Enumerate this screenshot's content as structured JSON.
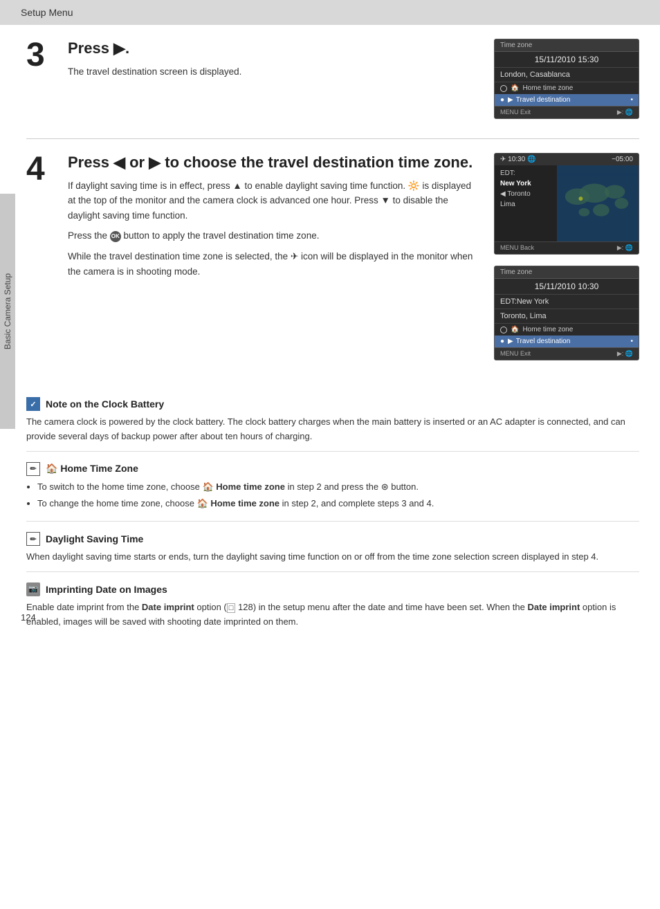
{
  "header": {
    "title": "Setup Menu"
  },
  "sidebar": {
    "label": "Basic Camera Setup"
  },
  "step3": {
    "number": "3",
    "title_prefix": "Press ",
    "title_arrow": "▶",
    "title_suffix": ".",
    "desc": "The travel destination screen is displayed.",
    "cam1": {
      "header": "Time zone",
      "date": "15/11/2010 15:30",
      "location": "London, Casablanca",
      "row1": "Home time zone",
      "row2": "Travel destination",
      "footer_left": "MENU Exit",
      "footer_right": "▶: 🌐"
    }
  },
  "step4": {
    "number": "4",
    "title": "Press ◀ or ▶ to choose the travel destination time zone.",
    "desc1": "If daylight saving time is in effect, press ▲ to enable daylight saving time function. 🔆 is displayed at the top of the monitor and the camera clock is advanced one hour. Press ▼ to disable the daylight saving time function.",
    "desc2": "Press the ⊛ button to apply the travel destination time zone.",
    "desc3": "While the travel destination time zone is selected, the ✈ icon will be displayed in the monitor when the camera is in shooting mode.",
    "cam_map": {
      "header_left": "✈ 10:30 🌐",
      "header_right": "−05:00",
      "cities": [
        "EDT:",
        "New York",
        "Toronto",
        "Lima"
      ],
      "footer_left": "MENU Back",
      "footer_right": "▶: 🌐"
    },
    "cam2": {
      "header": "Time zone",
      "date": "15/11/2010 10:30",
      "location1": "EDT:New York",
      "location2": "Toronto, Lima",
      "row1": "Home time zone",
      "row2": "Travel destination",
      "footer_left": "MENU Exit",
      "footer_right": "▶: 🌐"
    }
  },
  "note_clock": {
    "title": "Note on the Clock Battery",
    "body": "The camera clock is powered by the clock battery. The clock battery charges when the main battery is inserted or an AC adapter is connected, and can provide several days of backup power after about ten hours of charging."
  },
  "note_home": {
    "title": "🏠 Home Time Zone",
    "bullet1_pre": "To switch to the home time zone, choose ",
    "bullet1_bold": "🏠 Home time zone",
    "bullet1_post": " in step 2 and press the ⊛ button.",
    "bullet2_pre": "To change the home time zone, choose ",
    "bullet2_bold": "🏠 Home time zone",
    "bullet2_post": " in step 2, and complete steps 3 and 4."
  },
  "note_dst": {
    "title": "Daylight Saving Time",
    "body": "When daylight saving time starts or ends, turn the daylight saving time function on or off from the time zone selection screen displayed in step 4."
  },
  "note_imprint": {
    "title": "Imprinting Date on Images",
    "body_pre": "Enable date imprint from the ",
    "body_bold1": "Date imprint",
    "body_mid": " option (",
    "body_page": "□ 128",
    "body_mid2": ") in the setup menu after the date and time have been set. When the ",
    "body_bold2": "Date imprint",
    "body_post": " option is enabled, images will be saved with shooting date imprinted on them."
  },
  "page_number": "124"
}
